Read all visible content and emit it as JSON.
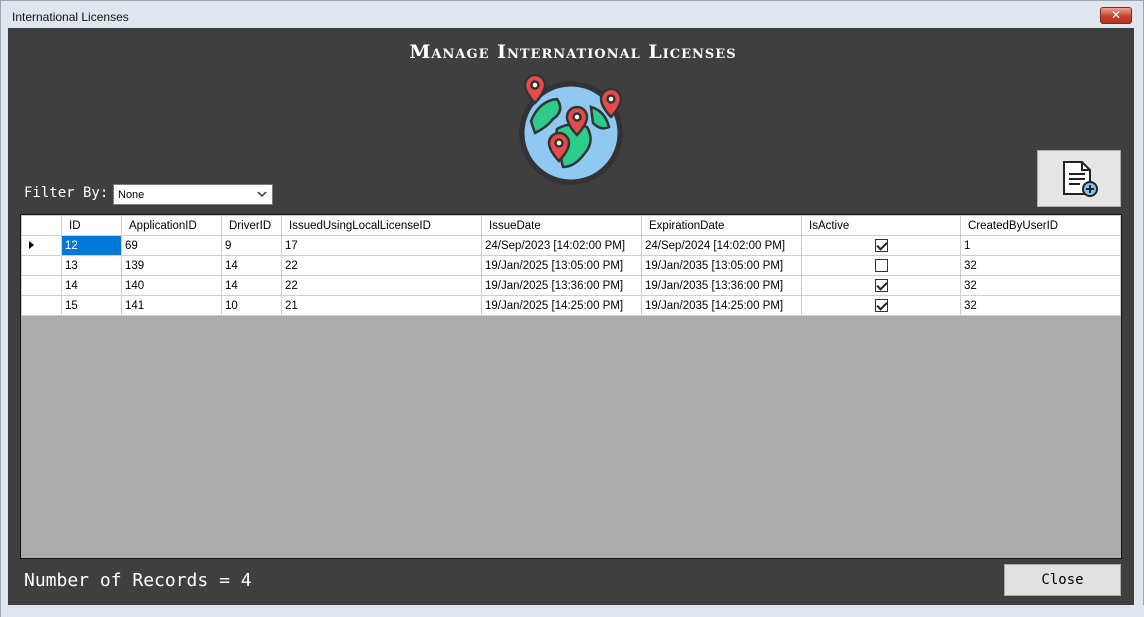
{
  "window": {
    "title": "International Licenses",
    "close_glyph": "✕"
  },
  "header": {
    "title": "Manage International Licenses",
    "icon": "globe-map-pins-icon"
  },
  "toolbar": {
    "add_button_icon": "document-add-icon"
  },
  "filter": {
    "label": "Filter By:",
    "selected": "None"
  },
  "grid": {
    "columns": [
      "ID",
      "ApplicationID",
      "DriverID",
      "IssuedUsingLocalLicenseID",
      "IssueDate",
      "ExpirationDate",
      "IsActive",
      "CreatedByUserID"
    ],
    "rows": [
      {
        "id": "12",
        "application_id": "69",
        "driver_id": "9",
        "local_license_id": "17",
        "issue_date": "24/Sep/2023 [14:02:00 PM]",
        "expiration_date": "24/Sep/2024 [14:02:00 PM]",
        "is_active": true,
        "created_by": "1"
      },
      {
        "id": "13",
        "application_id": "139",
        "driver_id": "14",
        "local_license_id": "22",
        "issue_date": "19/Jan/2025 [13:05:00 PM]",
        "expiration_date": "19/Jan/2035 [13:05:00 PM]",
        "is_active": false,
        "created_by": "32"
      },
      {
        "id": "14",
        "application_id": "140",
        "driver_id": "14",
        "local_license_id": "22",
        "issue_date": "19/Jan/2025 [13:36:00 PM]",
        "expiration_date": "19/Jan/2035 [13:36:00 PM]",
        "is_active": true,
        "created_by": "32"
      },
      {
        "id": "15",
        "application_id": "141",
        "driver_id": "10",
        "local_license_id": "21",
        "issue_date": "19/Jan/2025 [14:25:00 PM]",
        "expiration_date": "19/Jan/2035 [14:25:00 PM]",
        "is_active": true,
        "created_by": "32"
      }
    ],
    "selected_row": 0
  },
  "footer": {
    "records_text": "Number of Records = 4",
    "close_label": "Close"
  },
  "colors": {
    "background": "#3f3f3f",
    "grid_empty": "#ababab",
    "selection": "#0078d7",
    "pin": "#e84a4a",
    "land": "#2ecc8a",
    "ocean": "#8fc9f2"
  }
}
